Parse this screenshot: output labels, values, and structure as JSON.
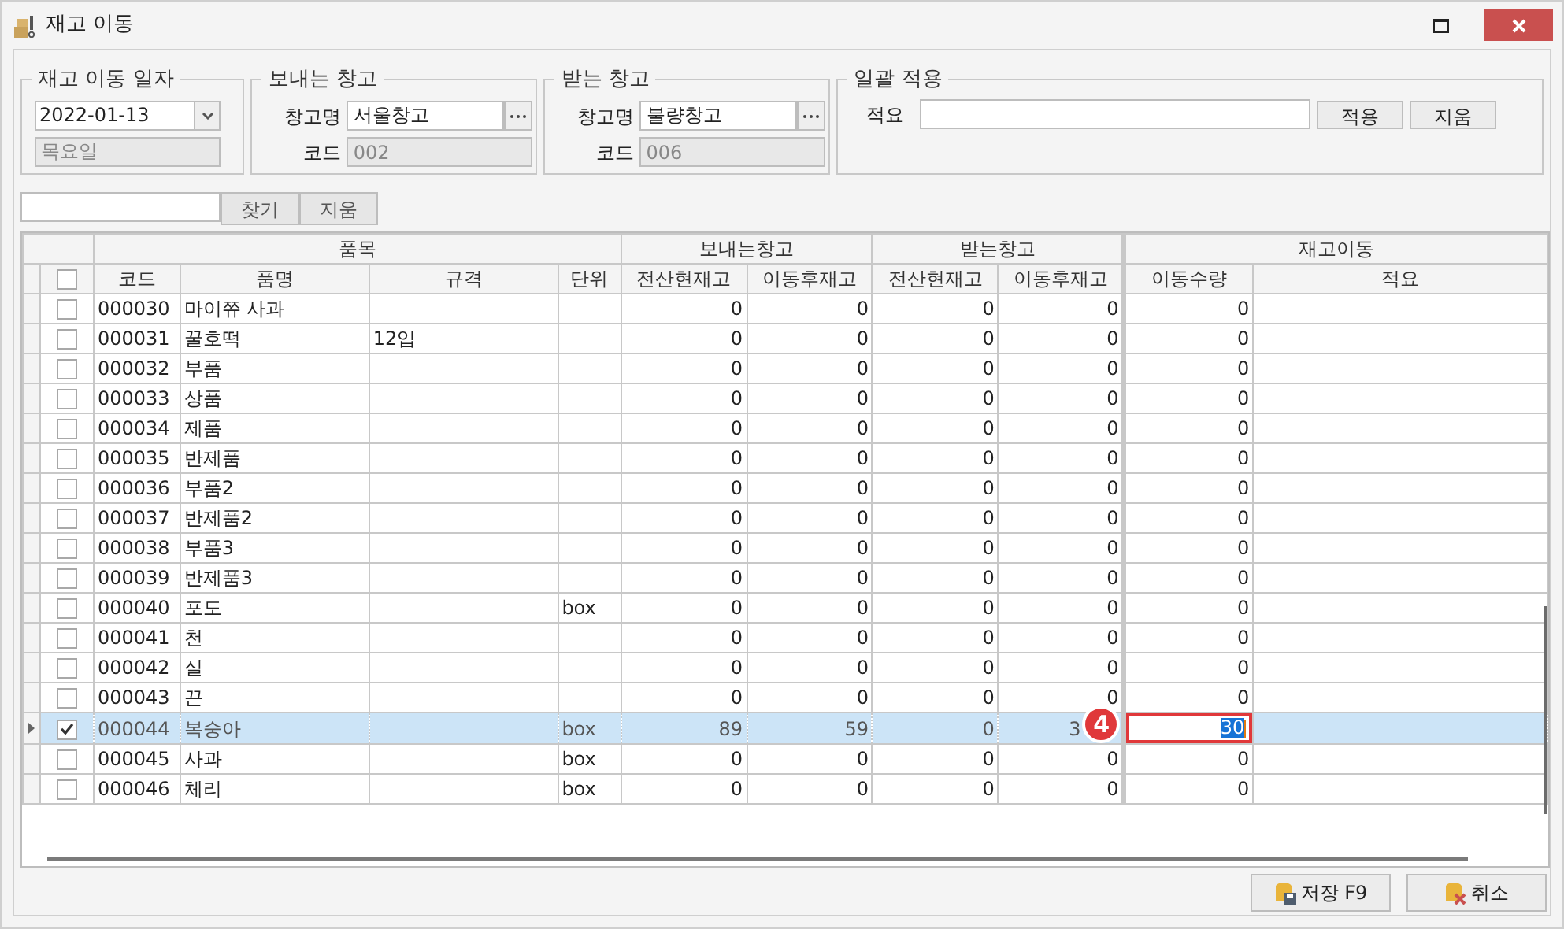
{
  "window": {
    "title": "재고 이동"
  },
  "date_group": {
    "title": "재고 이동 일자",
    "date": "2022-01-13",
    "weekday": "목요일"
  },
  "from_warehouse": {
    "title": "보내는 창고",
    "name_label": "창고명",
    "name": "서울창고",
    "code_label": "코드",
    "code": "002"
  },
  "to_warehouse": {
    "title": "받는 창고",
    "name_label": "창고명",
    "name": "불량창고",
    "code_label": "코드",
    "code": "006"
  },
  "bulk_apply": {
    "title": "일괄 적용",
    "memo_label": "적요",
    "apply": "적용",
    "clear": "지움"
  },
  "search": {
    "find": "찾기",
    "clear": "지움"
  },
  "grid": {
    "header_checked": false,
    "groups": [
      {
        "label": "품목",
        "columns": [
          "코드",
          "품명",
          "규격",
          "단위"
        ]
      },
      {
        "label": "보내는창고",
        "columns": [
          "전산현재고",
          "이동후재고"
        ]
      },
      {
        "label": "받는창고",
        "columns": [
          "전산현재고",
          "이동후재고"
        ]
      },
      {
        "label": "재고이동",
        "columns": [
          "이동수량",
          "적요"
        ]
      }
    ],
    "rows": [
      {
        "checked": false,
        "selected": false,
        "cells": [
          "000030",
          "마이쮸 사과",
          "",
          "",
          "0",
          "0",
          "0",
          "0",
          "0",
          ""
        ]
      },
      {
        "checked": false,
        "selected": false,
        "cells": [
          "000031",
          "꿀호떡",
          "12입",
          "",
          "0",
          "0",
          "0",
          "0",
          "0",
          ""
        ]
      },
      {
        "checked": false,
        "selected": false,
        "cells": [
          "000032",
          "부품",
          "",
          "",
          "0",
          "0",
          "0",
          "0",
          "0",
          ""
        ]
      },
      {
        "checked": false,
        "selected": false,
        "cells": [
          "000033",
          "상품",
          "",
          "",
          "0",
          "0",
          "0",
          "0",
          "0",
          ""
        ]
      },
      {
        "checked": false,
        "selected": false,
        "cells": [
          "000034",
          "제품",
          "",
          "",
          "0",
          "0",
          "0",
          "0",
          "0",
          ""
        ]
      },
      {
        "checked": false,
        "selected": false,
        "cells": [
          "000035",
          "반제품",
          "",
          "",
          "0",
          "0",
          "0",
          "0",
          "0",
          ""
        ]
      },
      {
        "checked": false,
        "selected": false,
        "cells": [
          "000036",
          "부품2",
          "",
          "",
          "0",
          "0",
          "0",
          "0",
          "0",
          ""
        ]
      },
      {
        "checked": false,
        "selected": false,
        "cells": [
          "000037",
          "반제품2",
          "",
          "",
          "0",
          "0",
          "0",
          "0",
          "0",
          ""
        ]
      },
      {
        "checked": false,
        "selected": false,
        "cells": [
          "000038",
          "부품3",
          "",
          "",
          "0",
          "0",
          "0",
          "0",
          "0",
          ""
        ]
      },
      {
        "checked": false,
        "selected": false,
        "cells": [
          "000039",
          "반제품3",
          "",
          "",
          "0",
          "0",
          "0",
          "0",
          "0",
          ""
        ]
      },
      {
        "checked": false,
        "selected": false,
        "cells": [
          "000040",
          "포도",
          "",
          "box",
          "0",
          "0",
          "0",
          "0",
          "0",
          ""
        ]
      },
      {
        "checked": false,
        "selected": false,
        "cells": [
          "000041",
          "천",
          "",
          "",
          "0",
          "0",
          "0",
          "0",
          "0",
          ""
        ]
      },
      {
        "checked": false,
        "selected": false,
        "cells": [
          "000042",
          "실",
          "",
          "",
          "0",
          "0",
          "0",
          "0",
          "0",
          ""
        ]
      },
      {
        "checked": false,
        "selected": false,
        "cells": [
          "000043",
          "끈",
          "",
          "",
          "0",
          "0",
          "0",
          "0",
          "0",
          ""
        ]
      },
      {
        "checked": true,
        "selected": true,
        "editing": true,
        "callout": "4",
        "cells": [
          "000044",
          "복숭아",
          "",
          "box",
          "89",
          "59",
          "0",
          "3",
          "30",
          ""
        ]
      },
      {
        "checked": false,
        "selected": false,
        "cells": [
          "000045",
          "사과",
          "",
          "box",
          "0",
          "0",
          "0",
          "0",
          "0",
          ""
        ]
      },
      {
        "checked": false,
        "selected": false,
        "cells": [
          "000046",
          "체리",
          "",
          "box",
          "0",
          "0",
          "0",
          "0",
          "0",
          ""
        ]
      }
    ]
  },
  "buttons": [
    {
      "kind": "save",
      "label": "저장 F9"
    },
    {
      "kind": "cancel",
      "label": "취소"
    }
  ]
}
